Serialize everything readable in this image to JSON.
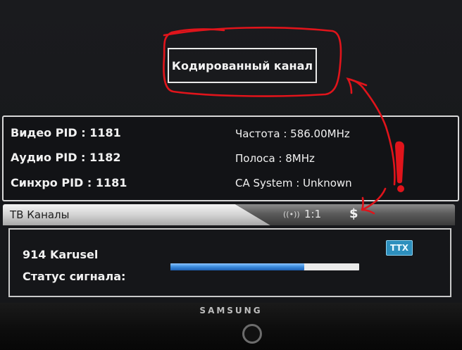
{
  "popup": {
    "message": "Кодированный канал"
  },
  "info": {
    "video_pid": "Видео PID : 1181",
    "audio_pid": "Аудио PID : 1182",
    "sync_pid": "Синхро PID : 1181",
    "frequency": "Частота : 586.00MHz",
    "bandwidth": "Полоса : 8MHz",
    "ca_system": "CA System : Unknown"
  },
  "tabbar": {
    "title": "ТВ Каналы",
    "ratio": "1:1",
    "scrambled_symbol": "$",
    "signal_icon": "signal-waves-icon"
  },
  "channel": {
    "name": "914  Karusel",
    "status_label": "Статус сигнала:",
    "signal_level": 0.71,
    "ttx_label": "TTX"
  },
  "bezel": {
    "brand": "SAMSUNG"
  },
  "colors": {
    "annotation": "#e0141b",
    "signal_fill": "#3f8fe0",
    "ttx_bg": "#2d8fbd"
  }
}
